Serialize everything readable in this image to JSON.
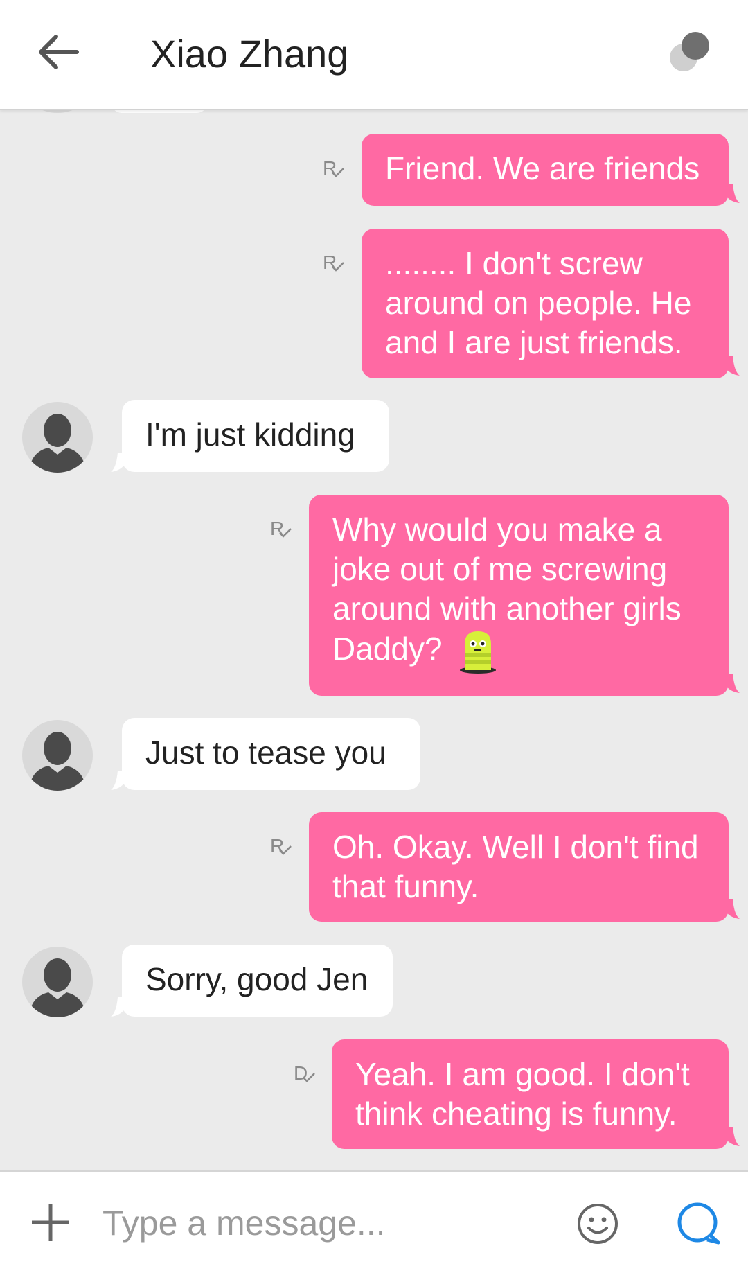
{
  "header": {
    "title": "Xiao Zhang",
    "back_icon": "arrow-left-icon",
    "theme_icon": "theme-circles-icon"
  },
  "colors": {
    "outgoing_bubble": "#ff69a3",
    "incoming_bubble": "#ffffff",
    "background": "#ebebeb",
    "send_icon": "#1e88e5"
  },
  "messages": [
    {
      "direction": "out",
      "status": "R",
      "text": "Friend. We are friends"
    },
    {
      "direction": "out",
      "status": "R",
      "text": "........ I don't screw around on people. He and I are just friends."
    },
    {
      "direction": "in",
      "text": "I'm just kidding"
    },
    {
      "direction": "out",
      "status": "R",
      "text": "Why would you make a joke out of me screwing around with another girls Daddy?",
      "emoji": "worm-emoji"
    },
    {
      "direction": "in",
      "text": "Just to tease you"
    },
    {
      "direction": "out",
      "status": "R",
      "text": "Oh. Okay. Well I don't find that funny."
    },
    {
      "direction": "in",
      "text": "Sorry, good Jen"
    },
    {
      "direction": "out",
      "status": "D",
      "text": "Yeah. I am good. I don't think cheating is funny."
    }
  ],
  "composer": {
    "placeholder": "Type a message...",
    "value": "",
    "attach_icon": "plus-icon",
    "emoji_icon": "smiley-icon",
    "send_icon": "send-bubble-icon"
  }
}
